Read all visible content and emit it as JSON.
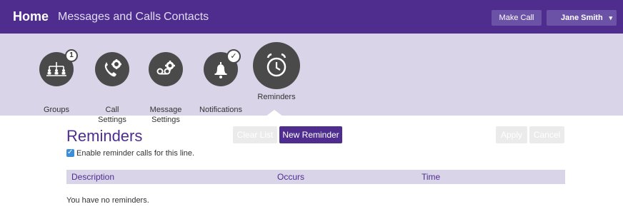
{
  "topbar": {
    "home": "Home",
    "messages_calls": "Messages and Calls",
    "contacts": "Contacts",
    "make_call": "Make Call",
    "user_name": "Jane Smith",
    "caret": "▾"
  },
  "tools": {
    "groups": {
      "label": "Groups",
      "badge": "1",
      "icon": "org-chart-icon"
    },
    "call_settings": {
      "label": "Call\nSettings",
      "icon": "phone-gear-icon"
    },
    "message_settings": {
      "label": "Message\nSettings",
      "icon": "voicemail-gear-icon"
    },
    "notifications": {
      "label": "Notifications",
      "badge": "✓",
      "icon": "bell-icon"
    },
    "reminders": {
      "label": "Reminders",
      "icon": "alarm-clock-icon"
    }
  },
  "main": {
    "title": "Reminders",
    "enable_label": "Enable reminder calls for this line.",
    "enable_checked": true,
    "clear_list": "Clear List",
    "new_reminder": "New Reminder",
    "apply": "Apply",
    "cancel": "Cancel",
    "columns": [
      "Description",
      "Occurs",
      "Time"
    ],
    "empty_message": "You have no reminders."
  },
  "colors": {
    "brand_purple": "#4e2d8f",
    "icon_bar_bg": "#d9d4e8",
    "icon_circle": "#4a4a4a",
    "checkbox_blue": "#3a8fd8"
  }
}
